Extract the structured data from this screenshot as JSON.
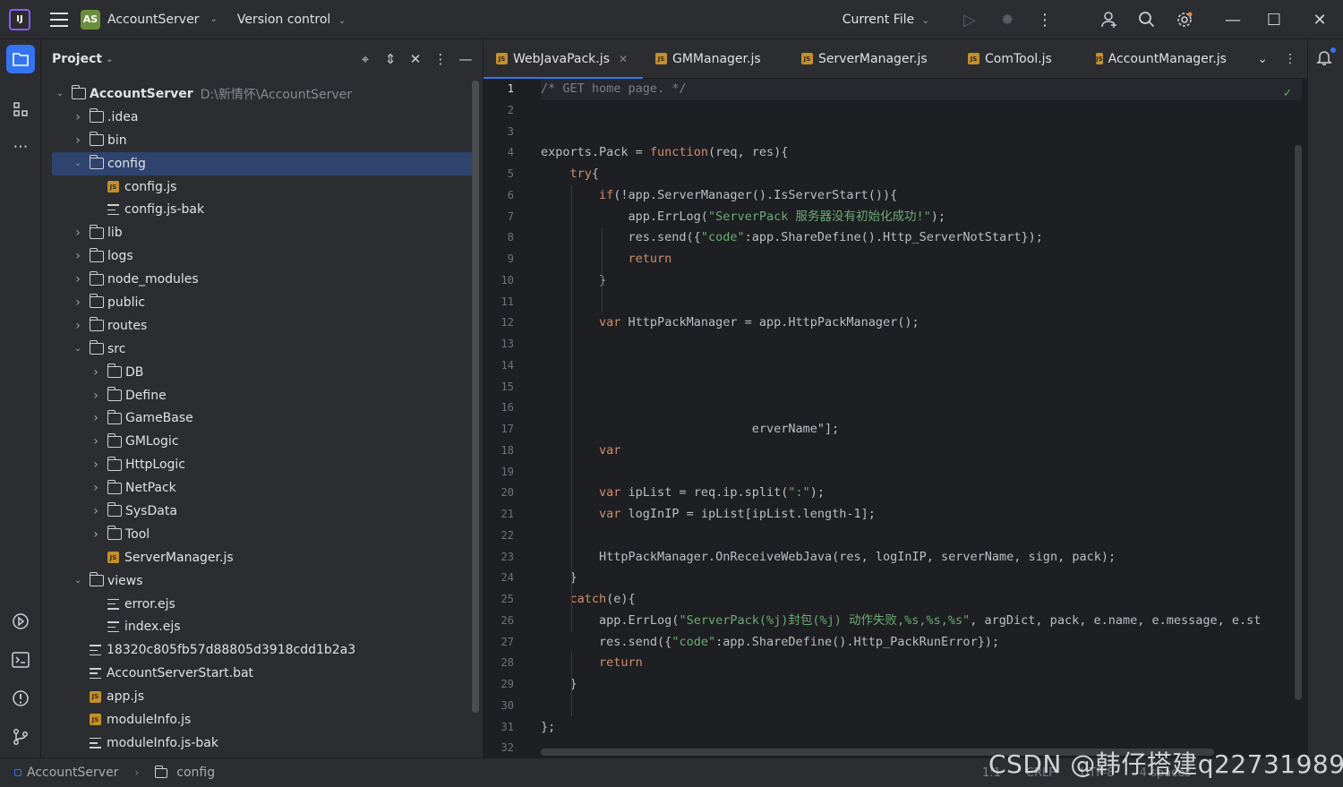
{
  "titlebar": {
    "app_logo": "IJ",
    "project_badge": "AS",
    "project_name": "AccountServer",
    "version_control": "Version control",
    "run_config": "Current File"
  },
  "project_panel": {
    "title": "Project",
    "tree": [
      {
        "depth": 0,
        "type": "folder",
        "expanded": true,
        "name": "AccountServer",
        "hint": "D:\\新情怀\\AccountServer"
      },
      {
        "depth": 1,
        "type": "folder",
        "expanded": false,
        "name": ".idea"
      },
      {
        "depth": 1,
        "type": "folder",
        "expanded": false,
        "name": "bin"
      },
      {
        "depth": 1,
        "type": "folder",
        "expanded": true,
        "name": "config",
        "selected": true
      },
      {
        "depth": 2,
        "type": "js",
        "name": "config.js"
      },
      {
        "depth": 2,
        "type": "text",
        "name": "config.js-bak"
      },
      {
        "depth": 1,
        "type": "folder",
        "expanded": false,
        "name": "lib"
      },
      {
        "depth": 1,
        "type": "folder",
        "expanded": false,
        "name": "logs"
      },
      {
        "depth": 1,
        "type": "folder",
        "expanded": false,
        "name": "node_modules"
      },
      {
        "depth": 1,
        "type": "folder",
        "expanded": false,
        "name": "public"
      },
      {
        "depth": 1,
        "type": "folder",
        "expanded": false,
        "name": "routes"
      },
      {
        "depth": 1,
        "type": "folder",
        "expanded": true,
        "name": "src"
      },
      {
        "depth": 2,
        "type": "folder",
        "expanded": false,
        "name": "DB"
      },
      {
        "depth": 2,
        "type": "folder",
        "expanded": false,
        "name": "Define"
      },
      {
        "depth": 2,
        "type": "folder",
        "expanded": false,
        "name": "GameBase"
      },
      {
        "depth": 2,
        "type": "folder",
        "expanded": false,
        "name": "GMLogic"
      },
      {
        "depth": 2,
        "type": "folder",
        "expanded": false,
        "name": "HttpLogic"
      },
      {
        "depth": 2,
        "type": "folder",
        "expanded": false,
        "name": "NetPack"
      },
      {
        "depth": 2,
        "type": "folder",
        "expanded": false,
        "name": "SysData"
      },
      {
        "depth": 2,
        "type": "folder",
        "expanded": false,
        "name": "Tool"
      },
      {
        "depth": 2,
        "type": "js",
        "name": "ServerManager.js"
      },
      {
        "depth": 1,
        "type": "folder",
        "expanded": true,
        "name": "views"
      },
      {
        "depth": 2,
        "type": "text",
        "name": "error.ejs"
      },
      {
        "depth": 2,
        "type": "text",
        "name": "index.ejs"
      },
      {
        "depth": 1,
        "type": "text",
        "name": "18320c805fb57d88805d3918cdd1b2a3"
      },
      {
        "depth": 1,
        "type": "text",
        "name": "AccountServerStart.bat"
      },
      {
        "depth": 1,
        "type": "js",
        "name": "app.js"
      },
      {
        "depth": 1,
        "type": "js",
        "name": "moduleInfo.js"
      },
      {
        "depth": 1,
        "type": "text",
        "name": "moduleInfo.js-bak"
      }
    ]
  },
  "editor": {
    "tabs": [
      {
        "label": "WebJavaPack.js",
        "active": true
      },
      {
        "label": "GMManager.js",
        "active": false
      },
      {
        "label": "ServerManager.js",
        "active": false
      },
      {
        "label": "ComTool.js",
        "active": false
      },
      {
        "label": "AccountManager.js",
        "active": false
      }
    ],
    "current_line": 1,
    "lines": [
      {
        "n": "1",
        "html": "<span class=\"cm\">/* GET home page. */</span>"
      },
      {
        "n": "2",
        "html": ""
      },
      {
        "n": "3",
        "html": ""
      },
      {
        "n": "4",
        "html": "exports.Pack = <span class=\"kw\">function</span>(req, res){"
      },
      {
        "n": "5",
        "html": "    <span class=\"kw\">try</span>{"
      },
      {
        "n": "6",
        "html": "        <span class=\"kw\">if</span>(!app.ServerManager().IsServerStart()){"
      },
      {
        "n": "7",
        "html": "            app.ErrLog(<span class=\"str\">\"ServerPack 服务器没有初始化成功!\"</span>);"
      },
      {
        "n": "8",
        "html": "            res.send({<span class=\"str\">\"code\"</span>:app.ShareDefine().Http_ServerNotStart});"
      },
      {
        "n": "9",
        "html": "            <span class=\"kw\">return</span>"
      },
      {
        "n": "10",
        "html": "        }"
      },
      {
        "n": "11",
        "html": ""
      },
      {
        "n": "12",
        "html": "        <span class=\"kw\">var</span> HttpPackManager = app.HttpPackManager();"
      },
      {
        "n": "13",
        "html": ""
      },
      {
        "n": "14",
        "html": ""
      },
      {
        "n": "15",
        "html": ""
      },
      {
        "n": "16",
        "html": ""
      },
      {
        "n": "17",
        "html": "                             erverName\"];"
      },
      {
        "n": "18",
        "html": "        <span class=\"kw\">var</span>"
      },
      {
        "n": "19",
        "html": ""
      },
      {
        "n": "20",
        "html": "        <span class=\"kw\">var</span> ipList = req.ip.split(<span class=\"str\">\":\"</span>);"
      },
      {
        "n": "21",
        "html": "        <span class=\"kw\">var</span> logInIP = ipList[ipList.length-1];"
      },
      {
        "n": "22",
        "html": ""
      },
      {
        "n": "23",
        "html": "        HttpPackManager.OnReceiveWebJava(res, logInIP, serverName, sign, pack);"
      },
      {
        "n": "24",
        "html": "    }"
      },
      {
        "n": "25",
        "html": "    <span class=\"kw\">catch</span>(e){"
      },
      {
        "n": "26",
        "html": "        app.ErrLog(<span class=\"str\">\"ServerPack(%j)封包(%j) 动作失败,%s,%s,%s\"</span>, argDict, pack, e.name, e.message, e.st"
      },
      {
        "n": "27",
        "html": "        res.send({<span class=\"str\">\"code\"</span>:app.ShareDefine().Http_PackRunError});"
      },
      {
        "n": "28",
        "html": "        <span class=\"kw\">return</span>"
      },
      {
        "n": "29",
        "html": "    }"
      },
      {
        "n": "30",
        "html": ""
      },
      {
        "n": "31",
        "html": "};"
      },
      {
        "n": "32",
        "html": ""
      }
    ]
  },
  "statusbar": {
    "crumb_project": "AccountServer",
    "crumb_folder": "config",
    "position": "1:1",
    "line_sep": "CRLF",
    "encoding": "UTF-8",
    "indent": "4 spaces"
  },
  "watermark": "CSDN @韩仔搭建q22731989",
  "colors": {
    "accent": "#3574f0",
    "selection": "#2e436e",
    "keyword": "#cf8e6d",
    "string": "#6aab73"
  }
}
